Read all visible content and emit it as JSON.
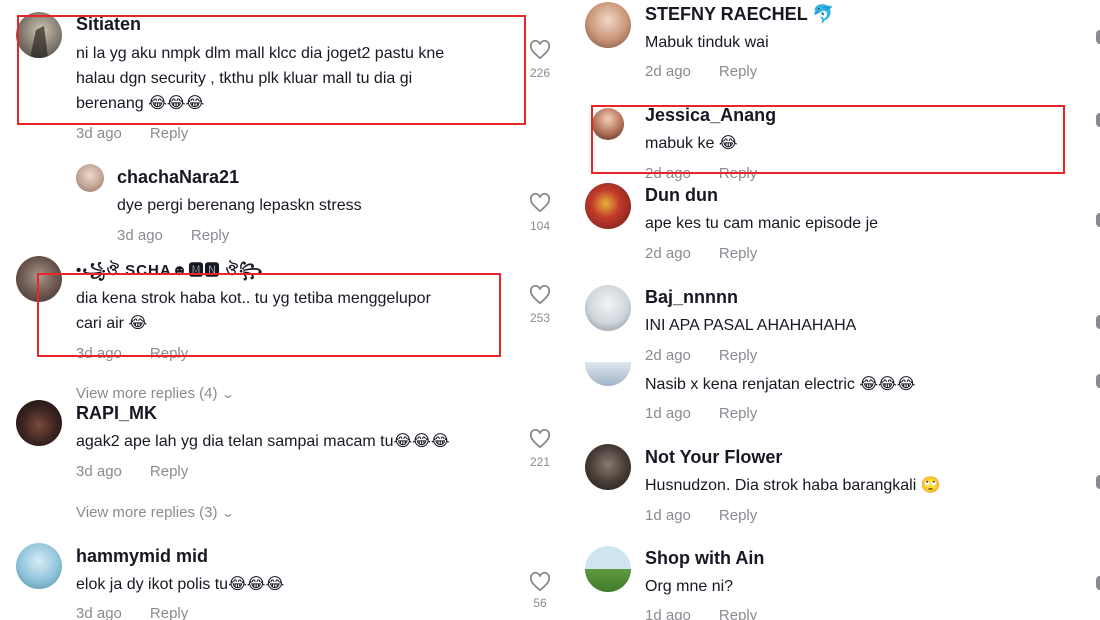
{
  "left": {
    "c1": {
      "user": "Sitiaten",
      "line1": "ni la yg aku nmpk dlm mall klcc dia joget2 pastu kne",
      "line2": "halau dgn security , tkthu plk kluar mall tu dia gi",
      "line3": "berenang 😂😂😂",
      "time": "3d ago",
      "reply": "Reply",
      "likes": "226"
    },
    "r1": {
      "user": "chachaNara21",
      "text": "dye pergi berenang lepaskn stress",
      "time": "3d ago",
      "reply": "Reply",
      "likes": "104"
    },
    "c2": {
      "user": "•꧁ঔ SCHA☻🅼🅽 ঔ꧂",
      "line1": "dia kena strok haba kot.. tu yg tetiba menggelupor",
      "line2": "cari air 😂",
      "time": "3d ago",
      "reply": "Reply",
      "likes": "253",
      "more": "View more replies (4)"
    },
    "c3": {
      "user": "RAPI_MK",
      "text": "agak2 ape lah yg dia telan sampai macam tu😂😂😂",
      "time": "3d ago",
      "reply": "Reply",
      "likes": "221",
      "more": "View more replies (3)"
    },
    "c4": {
      "user": "hammymid mid",
      "text": "elok ja dy ikot polis tu😂😂😂",
      "time": "3d ago",
      "reply": "Reply",
      "likes": "56"
    }
  },
  "right": {
    "c1": {
      "user": "STEFNY RAECHEL 🐬",
      "text": "Mabuk tinduk wai",
      "time": "2d ago",
      "reply": "Reply"
    },
    "c2": {
      "user": "Jessica_Anang",
      "text": "mabuk ke 😂",
      "time": "2d ago",
      "reply": "Reply"
    },
    "c3": {
      "user": "Dun dun",
      "text": "ape kes tu cam manic episode je",
      "time": "2d ago",
      "reply": "Reply"
    },
    "c4": {
      "user": "Baj_nnnnn",
      "text": "INI APA PASAL AHAHAHAHA",
      "time": "2d ago",
      "reply": "Reply"
    },
    "c5": {
      "text": "Nasib x kena renjatan electric 😂😂😂",
      "time": "1d ago",
      "reply": "Reply"
    },
    "c6": {
      "user": "Not Your Flower",
      "text": "Husnudzon. Dia strok haba barangkali 🙄",
      "time": "1d ago",
      "reply": "Reply"
    },
    "c7": {
      "user": "Shop with Ain",
      "text": "Org mne ni?",
      "time": "1d ago",
      "reply": "Reply"
    }
  },
  "icons": {
    "like": "heart-outline-icon",
    "chevron": "chevron-down-icon"
  },
  "colors": {
    "highlight_box": "#e8262a",
    "meta_gray": "#8a8b91",
    "text": "#161823"
  }
}
